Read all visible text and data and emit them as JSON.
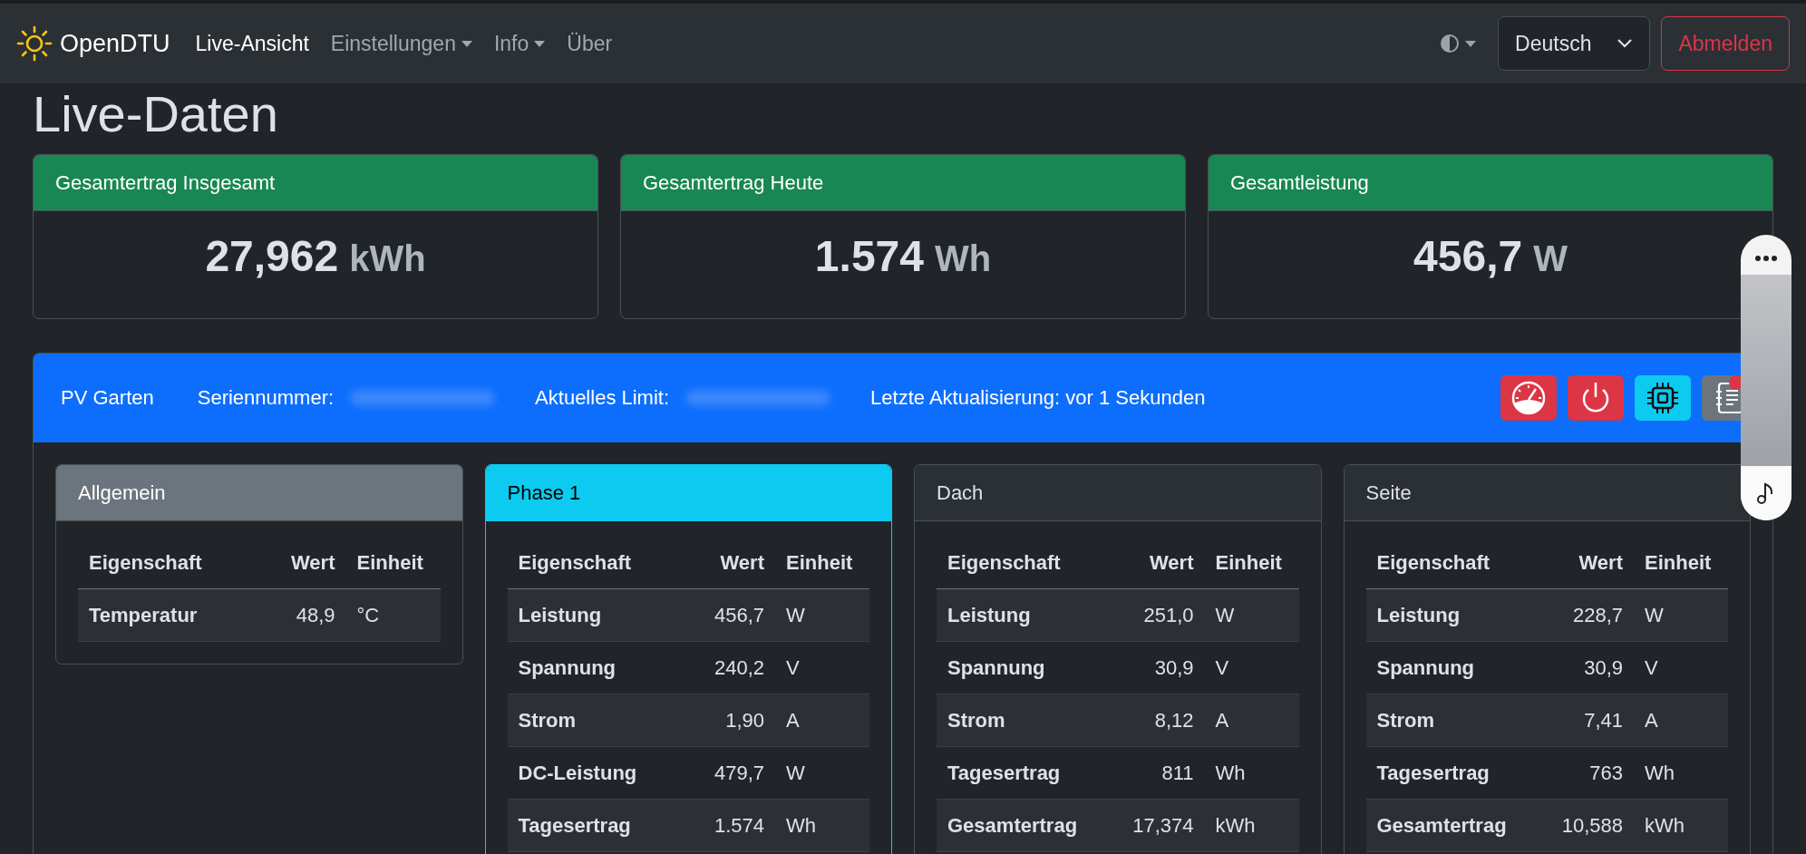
{
  "navbar": {
    "brand": "OpenDTU",
    "links": [
      {
        "label": "Live-Ansicht",
        "selected": true,
        "dropdown": false
      },
      {
        "label": "Einstellungen",
        "selected": false,
        "dropdown": true
      },
      {
        "label": "Info",
        "selected": false,
        "dropdown": true
      },
      {
        "label": "Über",
        "selected": false,
        "dropdown": false
      }
    ],
    "language": "Deutsch",
    "logout": "Abmelden"
  },
  "page_title": "Live-Daten",
  "totals": [
    {
      "title": "Gesamtertrag Insgesamt",
      "value": "27,962",
      "unit": "kWh"
    },
    {
      "title": "Gesamtertrag Heute",
      "value": "1.574",
      "unit": "Wh"
    },
    {
      "title": "Gesamtleistung",
      "value": "456,7",
      "unit": "W"
    }
  ],
  "inverter": {
    "name": "PV Garten",
    "serial_label": "Seriennummer:",
    "limit_label": "Aktuelles Limit:",
    "last_update": "Letzte Aktualisierung: vor 1 Sekunden",
    "buttons": [
      {
        "kind": "gauge",
        "color": "#dc3545",
        "badge": false
      },
      {
        "kind": "power",
        "color": "#dc3545",
        "badge": false
      },
      {
        "kind": "chip",
        "color": "#0dcaf0",
        "badge": false
      },
      {
        "kind": "log",
        "color": "#6c757d",
        "badge": true
      }
    ]
  },
  "channels": [
    {
      "title": "Allgemein",
      "kind": "general",
      "columns": [
        "Eigenschaft",
        "Wert",
        "Einheit"
      ],
      "rows": [
        {
          "property": "Temperatur",
          "value": "48,9",
          "unit": "°C"
        }
      ]
    },
    {
      "title": "Phase 1",
      "kind": "ac",
      "columns": [
        "Eigenschaft",
        "Wert",
        "Einheit"
      ],
      "rows": [
        {
          "property": "Leistung",
          "value": "456,7",
          "unit": "W"
        },
        {
          "property": "Spannung",
          "value": "240,2",
          "unit": "V"
        },
        {
          "property": "Strom",
          "value": "1,90",
          "unit": "A"
        },
        {
          "property": "DC-Leistung",
          "value": "479,7",
          "unit": "W"
        },
        {
          "property": "Tagesertrag",
          "value": "1.574",
          "unit": "Wh"
        }
      ]
    },
    {
      "title": "Dach",
      "kind": "dc",
      "columns": [
        "Eigenschaft",
        "Wert",
        "Einheit"
      ],
      "rows": [
        {
          "property": "Leistung",
          "value": "251,0",
          "unit": "W"
        },
        {
          "property": "Spannung",
          "value": "30,9",
          "unit": "V"
        },
        {
          "property": "Strom",
          "value": "8,12",
          "unit": "A"
        },
        {
          "property": "Tagesertrag",
          "value": "811",
          "unit": "Wh"
        },
        {
          "property": "Gesamtertrag",
          "value": "17,374",
          "unit": "kWh"
        }
      ]
    },
    {
      "title": "Seite",
      "kind": "dc",
      "columns": [
        "Eigenschaft",
        "Wert",
        "Einheit"
      ],
      "rows": [
        {
          "property": "Leistung",
          "value": "228,7",
          "unit": "W"
        },
        {
          "property": "Spannung",
          "value": "30,9",
          "unit": "V"
        },
        {
          "property": "Strom",
          "value": "7,41",
          "unit": "A"
        },
        {
          "property": "Tagesertrag",
          "value": "763",
          "unit": "Wh"
        },
        {
          "property": "Gesamtertrag",
          "value": "10,588",
          "unit": "kWh"
        }
      ]
    }
  ]
}
